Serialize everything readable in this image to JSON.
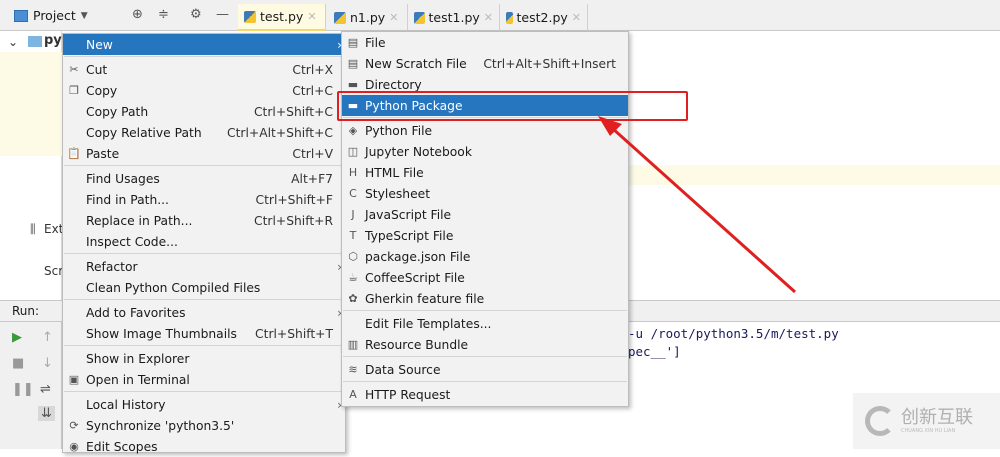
{
  "toolbar": {
    "project_label": "Project",
    "tabs": [
      "test.py",
      "n1.py",
      "test1.py",
      "test2.py"
    ]
  },
  "tree": {
    "items": [
      "py",
      "Ext",
      "Scr"
    ]
  },
  "run": {
    "label": "Run:"
  },
  "console": {
    "lines": [
      "-u /root/python3.5/m/test.py",
      "pec__']"
    ]
  },
  "context_menu": {
    "items": [
      {
        "label": "New",
        "submenu": true,
        "selected": true
      },
      {
        "sep": true
      },
      {
        "label": "Cut",
        "shortcut": "Ctrl+X",
        "icon": "scissors-icon"
      },
      {
        "label": "Copy",
        "shortcut": "Ctrl+C",
        "icon": "copy-icon"
      },
      {
        "label": "Copy Path",
        "shortcut": "Ctrl+Shift+C"
      },
      {
        "label": "Copy Relative Path",
        "shortcut": "Ctrl+Alt+Shift+C"
      },
      {
        "label": "Paste",
        "shortcut": "Ctrl+V",
        "icon": "paste-icon"
      },
      {
        "sep": true
      },
      {
        "label": "Find Usages",
        "shortcut": "Alt+F7"
      },
      {
        "label": "Find in Path...",
        "shortcut": "Ctrl+Shift+F"
      },
      {
        "label": "Replace in Path...",
        "shortcut": "Ctrl+Shift+R"
      },
      {
        "label": "Inspect Code..."
      },
      {
        "sep": true
      },
      {
        "label": "Refactor",
        "submenu": true
      },
      {
        "label": "Clean Python Compiled Files"
      },
      {
        "sep": true
      },
      {
        "label": "Add to Favorites",
        "submenu": true
      },
      {
        "label": "Show Image Thumbnails",
        "shortcut": "Ctrl+Shift+T"
      },
      {
        "sep": true
      },
      {
        "label": "Show in Explorer"
      },
      {
        "label": "Open in Terminal",
        "icon": "terminal-icon"
      },
      {
        "sep": true
      },
      {
        "label": "Local History",
        "submenu": true
      },
      {
        "label": "Synchronize 'python3.5'",
        "icon": "sync-icon"
      },
      {
        "label": "Edit Scopes",
        "icon": "scope-icon"
      }
    ]
  },
  "new_submenu": {
    "items": [
      {
        "label": "File",
        "icon": "file-icon"
      },
      {
        "label": "New Scratch File",
        "shortcut": "Ctrl+Alt+Shift+Insert",
        "icon": "scratch-file-icon"
      },
      {
        "label": "Directory",
        "icon": "folder-icon"
      },
      {
        "label": "Python Package",
        "icon": "package-icon",
        "selected": true
      },
      {
        "sep": true
      },
      {
        "label": "Python File",
        "icon": "python-file-icon"
      },
      {
        "label": "Jupyter Notebook",
        "icon": "jupyter-icon"
      },
      {
        "label": "HTML File",
        "icon": "html-file-icon"
      },
      {
        "label": "Stylesheet",
        "icon": "css-file-icon"
      },
      {
        "label": "JavaScript File",
        "icon": "js-file-icon"
      },
      {
        "label": "TypeScript File",
        "icon": "ts-file-icon"
      },
      {
        "label": "package.json File",
        "icon": "nodejs-icon"
      },
      {
        "label": "CoffeeScript File",
        "icon": "coffeescript-icon"
      },
      {
        "label": "Gherkin feature file",
        "icon": "gherkin-icon"
      },
      {
        "sep": true
      },
      {
        "label": "Edit File Templates..."
      },
      {
        "label": "Resource Bundle",
        "icon": "resource-bundle-icon"
      },
      {
        "sep": true
      },
      {
        "label": "Data Source",
        "icon": "database-icon"
      },
      {
        "sep": true
      },
      {
        "label": "HTTP Request",
        "icon": "api-icon"
      }
    ]
  },
  "watermark": {
    "text": "创新互联",
    "sub": "CHUANG XIN HU LIAN"
  },
  "colors": {
    "selection": "#2675bf",
    "annotation": "#e02020"
  }
}
